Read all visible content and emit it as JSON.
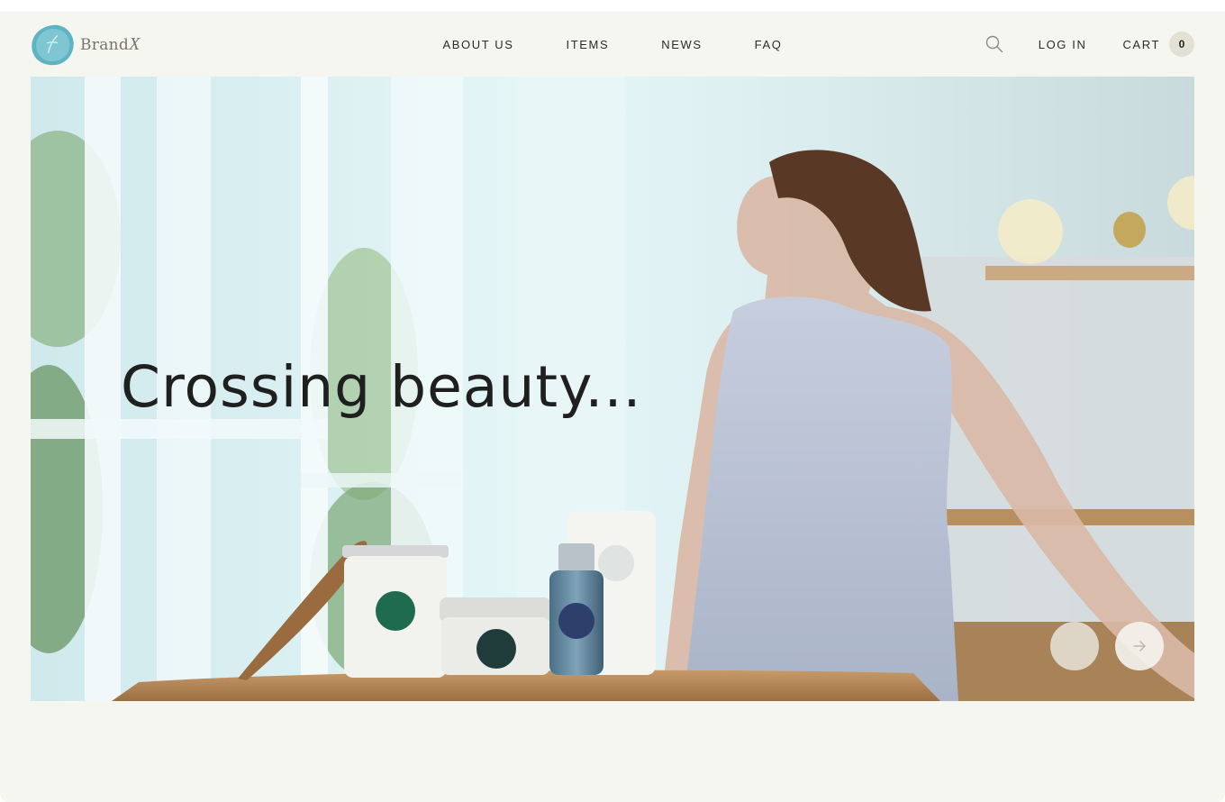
{
  "brand": {
    "name": "Brand",
    "mark": "X"
  },
  "nav": {
    "items": [
      "ABOUT US",
      "ITEMS",
      "NEWS",
      "FAQ"
    ]
  },
  "actions": {
    "search_icon": "search-icon",
    "login_label": "LOG IN",
    "cart_label": "CART",
    "cart_count": "0"
  },
  "hero": {
    "heading": "Crossing beauty..."
  },
  "slider": {
    "prev_icon": "arrow-left-icon",
    "next_icon": "arrow-right-icon"
  },
  "colors": {
    "page_background": "#f6f6f1",
    "text": "#2a2a2a",
    "cart_badge": "#e3e1d4",
    "brand_seal": "#63b7c5",
    "brand_text": "#7a7466"
  }
}
